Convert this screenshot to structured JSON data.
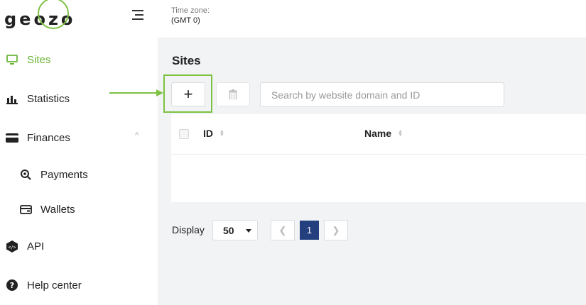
{
  "logo": {
    "text": "geozo",
    "accent": "#7dc242"
  },
  "sidebar": {
    "items": [
      {
        "label": "Sites",
        "icon": "monitor-icon",
        "active": true
      },
      {
        "label": "Statistics",
        "icon": "bar-chart-icon"
      },
      {
        "label": "Finances",
        "icon": "card-icon",
        "expanded": true
      },
      {
        "label": "Payments",
        "icon": "magnifier-coin-icon",
        "sub": true
      },
      {
        "label": "Wallets",
        "icon": "wallet-icon",
        "sub": true
      },
      {
        "label": "API",
        "icon": "code-hexagon-icon"
      },
      {
        "label": "Help center",
        "icon": "help-circle-icon"
      }
    ]
  },
  "topbar": {
    "timezone_label": "Time zone:",
    "timezone_value": "(GMT 0)"
  },
  "main": {
    "title": "Sites",
    "add_label": "+",
    "search_placeholder": "Search by website domain and ID",
    "columns": [
      "ID",
      "Name"
    ],
    "rows": []
  },
  "pagination": {
    "display_label": "Display",
    "page_size": "50",
    "current_page": "1",
    "prev_label": "❮",
    "next_label": "❯"
  },
  "colors": {
    "accent_green": "#7dc242",
    "active_page": "#243f7e",
    "sidebar_active": "#6bb536"
  }
}
